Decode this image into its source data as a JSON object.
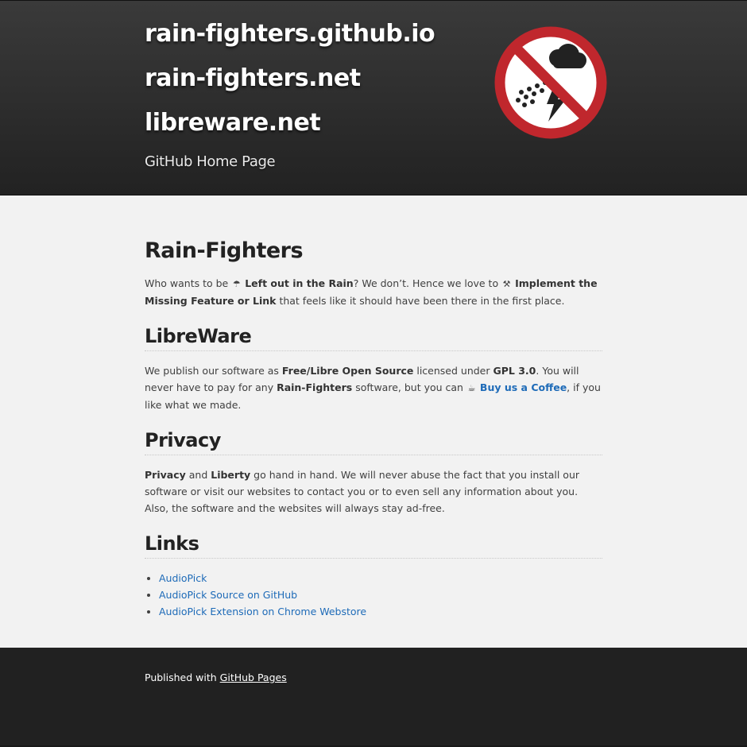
{
  "header": {
    "titles": [
      "rain-fighters.github.io",
      "rain-fighters.net",
      "libreware.net"
    ],
    "tagline": "GitHub Home Page",
    "logo_icon": "no-rain-sign-icon"
  },
  "content": {
    "heading": "Rain-Fighters",
    "intro": {
      "t1": "Who wants to be ",
      "umbrella_glyph": "☂",
      "b1": "Left out in the Rain",
      "t2": "? We don’t. Hence we love to ",
      "tools_glyph": "⚒",
      "b2": "Implement the Missing Feature or Link",
      "t3": " that feels like it should have been there in the first place."
    },
    "libreware": {
      "heading": "LibreWare",
      "t1": "We publish our software as ",
      "b1": "Free/Libre Open Source",
      "t2": " licensed under ",
      "b2": "GPL 3.0",
      "t3": ". You will never have to pay for any ",
      "b3": "Rain-Fighters",
      "t4": " software, but you can ",
      "coffee_glyph": "☕",
      "link": "Buy us a Coffee",
      "t5": ", if you like what we made."
    },
    "privacy": {
      "heading": "Privacy",
      "b1": "Privacy",
      "t1": " and ",
      "b2": "Liberty",
      "t2": " go hand in hand. We will never abuse the fact that you install our software or visit our websites to contact you or to even sell any information about you. Also, the software and the websites will always stay ad-free."
    },
    "links": {
      "heading": "Links",
      "items": [
        "AudioPick",
        "AudioPick Source on GitHub",
        "AudioPick Extension on Chrome Webstore"
      ]
    }
  },
  "footer": {
    "text": "Published with ",
    "link": "GitHub Pages"
  },
  "colors": {
    "link": "#1e6bb8",
    "sign_red": "#c0272d",
    "header_bg": "#2e2e2e",
    "footer_bg": "#212121"
  }
}
